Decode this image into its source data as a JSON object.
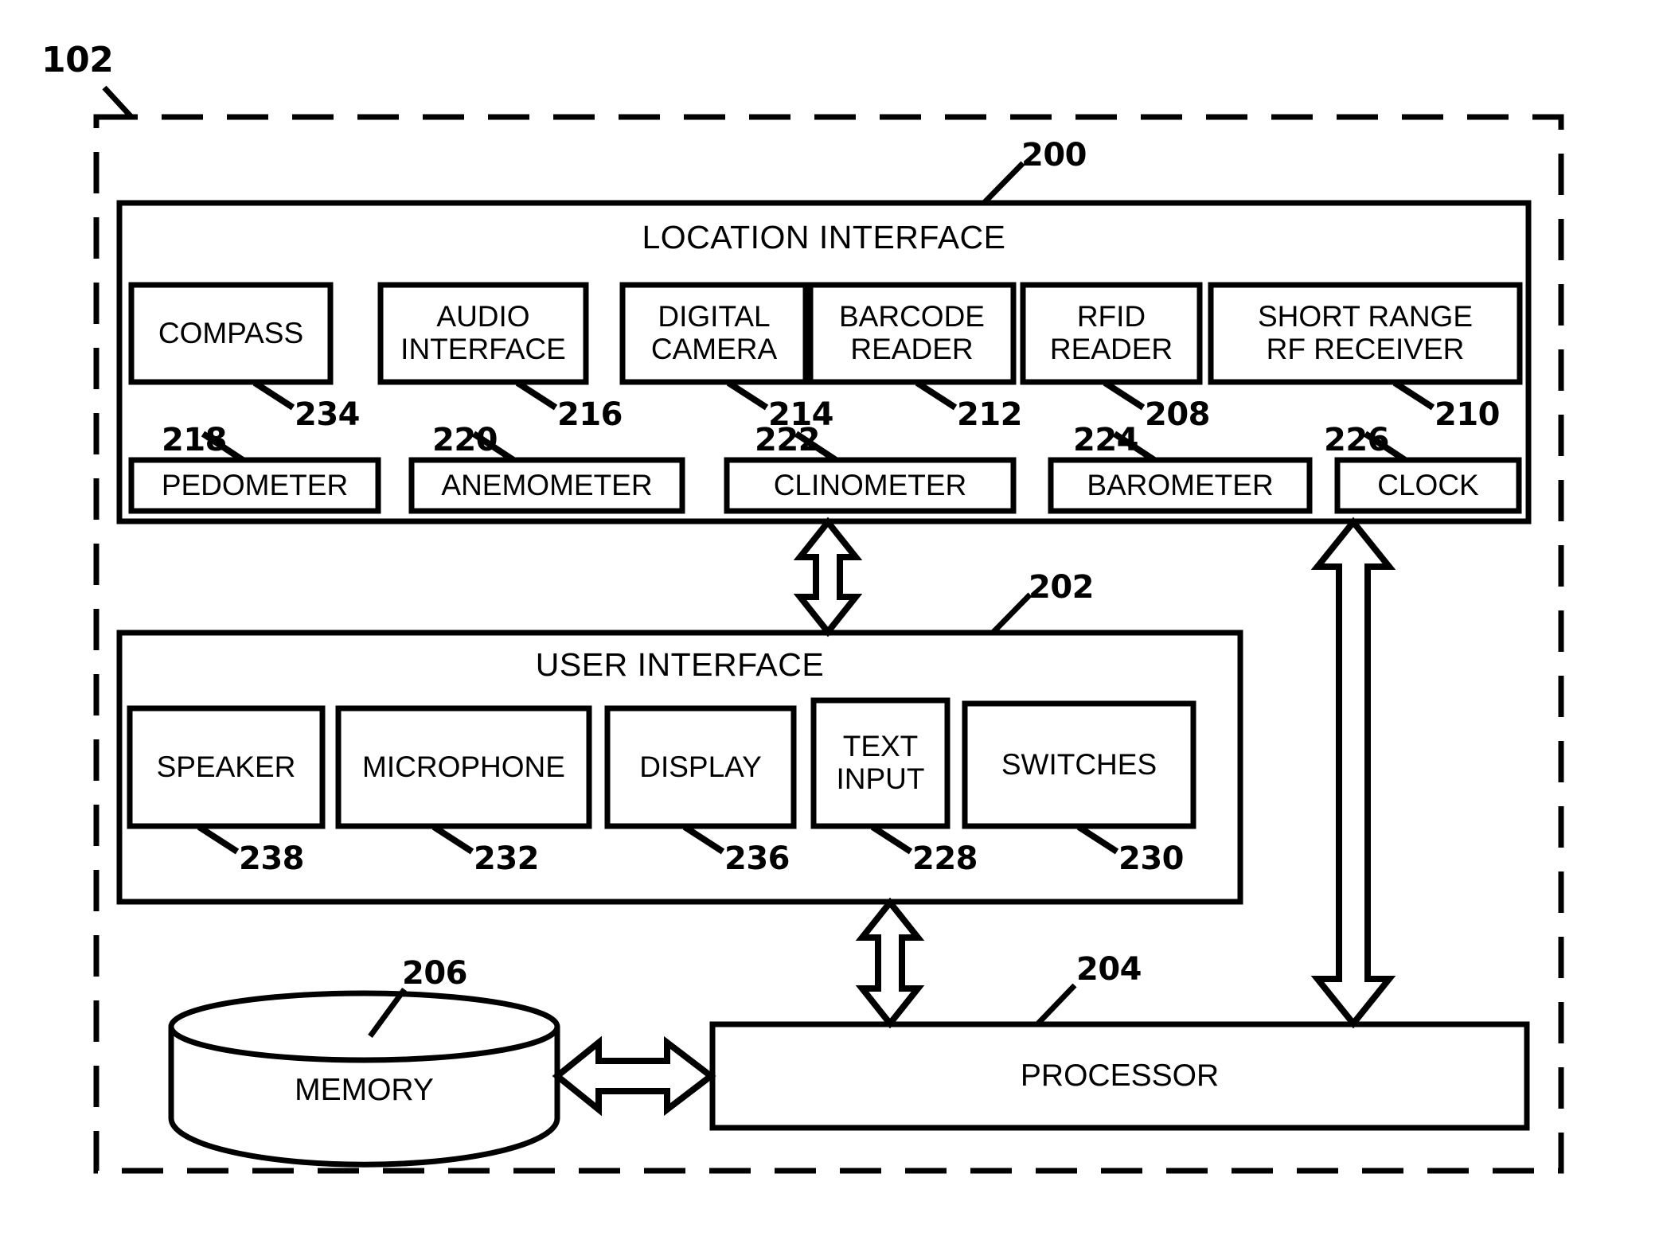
{
  "figure": {
    "type": "patent-block-diagram",
    "device_ref": "102",
    "background": "#ffffff",
    "stroke": "#000000"
  },
  "outer": {
    "name": "device-boundary",
    "ref": "102",
    "style": "dashed"
  },
  "sections": [
    {
      "id": "location-interface",
      "title": "LOCATION INTERFACE",
      "ref": "200"
    },
    {
      "id": "user-interface",
      "title": "USER INTERFACE",
      "ref": "202"
    }
  ],
  "location_interface": {
    "title": "LOCATION INTERFACE",
    "ref": "200",
    "row1": [
      {
        "label": "COMPASS",
        "ref": "234"
      },
      {
        "label": "AUDIO\nINTERFACE",
        "ref": "216"
      },
      {
        "label": "DIGITAL\nCAMERA",
        "ref": "214"
      },
      {
        "label": "BARCODE\nREADER",
        "ref": "212"
      },
      {
        "label": "RFID\nREADER",
        "ref": "208"
      },
      {
        "label": "SHORT RANGE\nRF RECEIVER",
        "ref": "210"
      }
    ],
    "row2": [
      {
        "label": "PEDOMETER",
        "ref": "218"
      },
      {
        "label": "ANEMOMETER",
        "ref": "220"
      },
      {
        "label": "CLINOMETER",
        "ref": "222"
      },
      {
        "label": "BAROMETER",
        "ref": "224"
      },
      {
        "label": "CLOCK",
        "ref": "226"
      }
    ]
  },
  "user_interface": {
    "title": "USER INTERFACE",
    "ref": "202",
    "items": [
      {
        "label": "SPEAKER",
        "ref": "238"
      },
      {
        "label": "MICROPHONE",
        "ref": "232"
      },
      {
        "label": "DISPLAY",
        "ref": "236"
      },
      {
        "label": "TEXT\nINPUT",
        "ref": "228"
      },
      {
        "label": "SWITCHES",
        "ref": "230"
      }
    ]
  },
  "memory": {
    "label": "MEMORY",
    "ref": "206",
    "shape": "cylinder"
  },
  "processor": {
    "label": "PROCESSOR",
    "ref": "204",
    "shape": "rectangle"
  },
  "connectors": [
    {
      "name": "location-to-user",
      "orientation": "vertical",
      "heads": "both"
    },
    {
      "name": "user-to-processor",
      "orientation": "vertical",
      "heads": "both"
    },
    {
      "name": "location-to-processor",
      "orientation": "vertical",
      "heads": "both"
    },
    {
      "name": "memory-to-processor",
      "orientation": "horizontal",
      "heads": "both"
    }
  ]
}
